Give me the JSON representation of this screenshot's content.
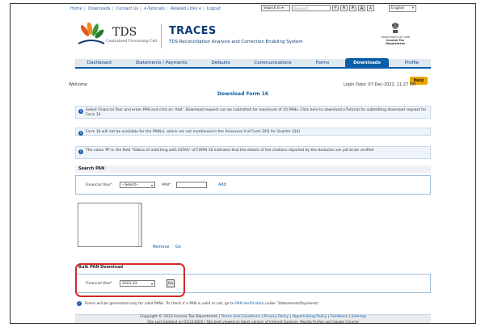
{
  "topbar": {
    "links": [
      "Home",
      "Downloads",
      "Contact Us",
      "e-Tutorials",
      "Related Links ▾",
      "Logout"
    ],
    "search_select": "Search In ▾",
    "search_placeholder": "Keyword",
    "font_buttons": [
      "A",
      "A",
      "A"
    ],
    "language": "English"
  },
  "header": {
    "tds_logo_text": "TDS",
    "tds_subtitle": "Centralised Processing Cell",
    "app_name": "TRACES",
    "app_subtitle": "TDS Reconciliation Analysis and Correction Enabling System",
    "gov_line1": "Government of India",
    "gov_line2": "Income Tax Department"
  },
  "nav": {
    "tabs": [
      {
        "label": "Dashboard"
      },
      {
        "label": "Statements / Payments"
      },
      {
        "label": "Defaults"
      },
      {
        "label": "Communications"
      },
      {
        "label": "Forms"
      },
      {
        "label": "Downloads"
      },
      {
        "label": "Profile"
      }
    ],
    "active": "Downloads"
  },
  "help_label": "Help",
  "welcome": "Welcome",
  "login_date": "Login Date: 07-Dec-2022, 11:27 PM",
  "page_title": "Download Form 16",
  "notes": {
    "n1": "Select Financial Year and enter PAN and click on 'Add'. Download request can be submitted for maximum of 10 PANs. Click here to download e-Tutorial for submitting download request for Form 16",
    "n2": "Form 16 will not be available for the PAN(s), which are not mentioned in the Annexure II of Form 24Q for Quarter (Q4)",
    "n3": "The value 'M' in the field \"Status of matching with OLTAS\" of FORM 16 indicates that the details of the challans reported by the deductor are yet to be verified"
  },
  "search_pan": {
    "heading": "Search PAN",
    "fy_label": "Financial Year",
    "fy_value": "--Select--",
    "pan_label": "PAN",
    "add_label": "Add"
  },
  "list_actions": {
    "remove": "Remove",
    "go": "Go"
  },
  "bulk": {
    "heading": "Bulk PAN Download",
    "fy_label": "Financial Year",
    "fy_value": "2021-22",
    "go": "Go"
  },
  "forms_note": {
    "text": "Forms will be generated only for valid PANs. To check if a PAN is valid or not, go to",
    "link": "PAN Verification",
    "suffix": "under 'Statements/Payments'"
  },
  "footer": {
    "copyright": "Copyright © 2012 Income Tax Department",
    "links": [
      "Terms and Conditions",
      "Privacy Policy",
      "Hyperlinking Policy",
      "Feedback",
      "Sitemap"
    ],
    "updated": "Site Last Updated on 01/12/2022",
    "browser": "Site best viewed on latest version of Internet Explorer, Mozilla Firefox and Google Chrome"
  }
}
